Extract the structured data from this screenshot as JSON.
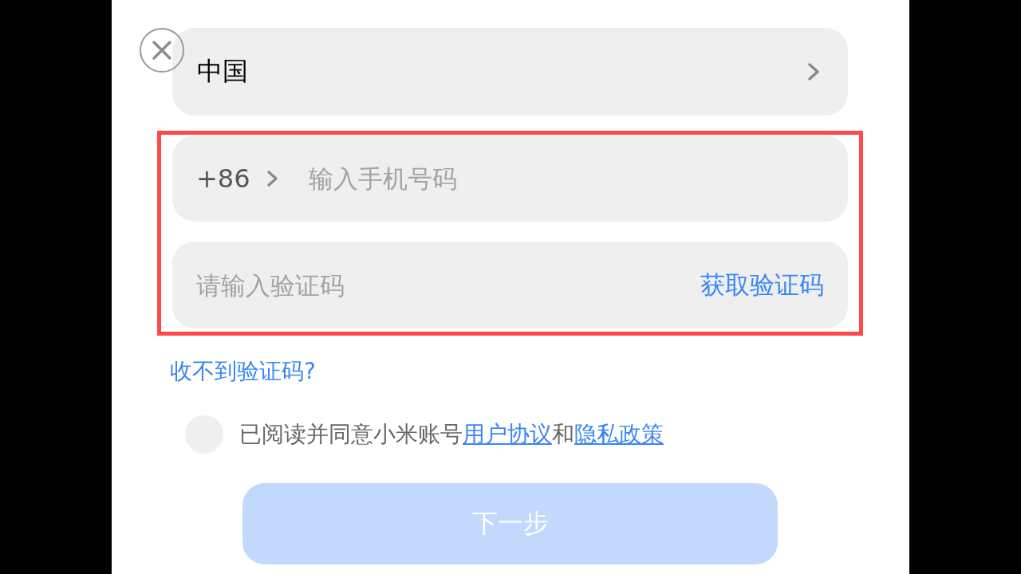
{
  "region_selector": {
    "label": "中国"
  },
  "verification_section": {
    "highlighted": true,
    "phone": {
      "country_code": "+86",
      "placeholder": "输入手机号码"
    },
    "code": {
      "placeholder": "请输入验证码",
      "action": "获取验证码"
    }
  },
  "help_link": "收不到验证码?",
  "agreement": {
    "checked": false,
    "parts": [
      {
        "kind": "text",
        "text": "已阅读并同意小米账号"
      },
      {
        "kind": "link",
        "text": "用户协议"
      },
      {
        "kind": "text",
        "text": "和"
      },
      {
        "kind": "link",
        "text": "隐私政策"
      }
    ]
  },
  "next_button": {
    "label": "下一步",
    "disabled": true
  }
}
